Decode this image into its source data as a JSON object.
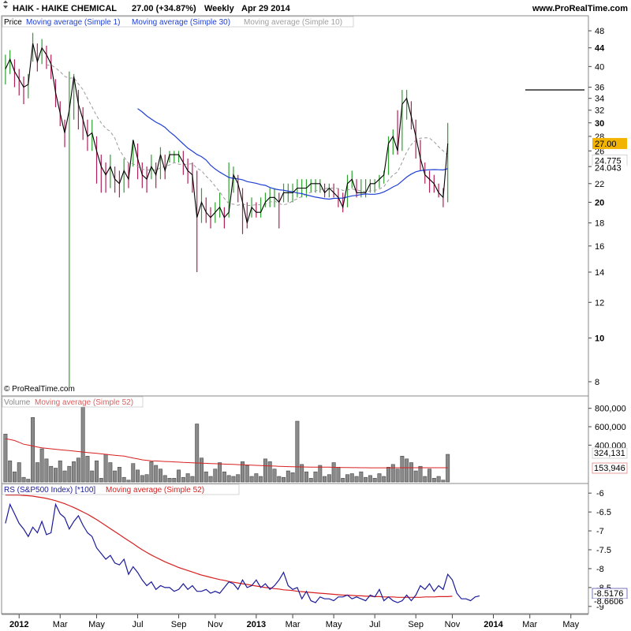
{
  "header": {
    "title": "HAIK - HAIKE CHEMICAL",
    "quote": "27.00 (+34.87%)",
    "period": "Weekly",
    "date": "Apr 29 2014",
    "site": "www.ProRealTime.com"
  },
  "copyright": "© ProRealTime.com",
  "colors": {
    "up": "#2ea02e",
    "down": "#b0205a",
    "close_line": "#000000",
    "ma_short": "#1f3fd6",
    "ma_long": "#9a9a9a",
    "volume_bar": "#8a8a8a",
    "ma52": "#d82020",
    "rs_line": "#1a1a9a",
    "price_badge": "#f2b400"
  },
  "chart_data": [
    {
      "type": "line",
      "panel": "price",
      "scale": "log",
      "legend": [
        "Price",
        "Moving average (Simple 1)",
        "Moving average (Simple 30)",
        "Moving average (Simple 10)"
      ],
      "y_ticks": [
        8,
        10,
        12,
        14,
        16,
        18,
        20,
        22,
        24,
        26,
        28,
        30,
        32,
        34,
        36,
        40,
        44,
        48
      ],
      "y_bold_ticks": [
        10,
        20,
        30,
        44
      ],
      "ylim": [
        7.5,
        51
      ],
      "x_labels": [
        {
          "label": "2012",
          "week": 3,
          "bold": true
        },
        {
          "label": "Mar",
          "week": 12
        },
        {
          "label": "May",
          "week": 20
        },
        {
          "label": "Jul",
          "week": 29
        },
        {
          "label": "Sep",
          "week": 38
        },
        {
          "label": "Nov",
          "week": 46
        },
        {
          "label": "2013",
          "week": 55,
          "bold": true
        },
        {
          "label": "Mar",
          "week": 63
        },
        {
          "label": "May",
          "week": 72
        },
        {
          "label": "Jul",
          "week": 81
        },
        {
          "label": "Sep",
          "week": 90
        },
        {
          "label": "Nov",
          "week": 98
        },
        {
          "label": "2014",
          "week": 107,
          "bold": true
        },
        {
          "label": "Mar",
          "week": 115
        },
        {
          "label": "May",
          "week": 124
        }
      ],
      "close": [
        39.5,
        41.5,
        39,
        37.5,
        36,
        36.5,
        45,
        41,
        44,
        42.5,
        40.5,
        35,
        31.5,
        28.5,
        32,
        38,
        33,
        30.5,
        28,
        28.5,
        26,
        24,
        23,
        24,
        22.5,
        22,
        23.5,
        22.5,
        27.5,
        25,
        23,
        22.5,
        24,
        23,
        25.5,
        23.5,
        25.5,
        25.5,
        25.5,
        24.5,
        23.5,
        23,
        18.5,
        20,
        19,
        18.5,
        19,
        19.5,
        18.5,
        19,
        23,
        22,
        20,
        18,
        19.5,
        19,
        19,
        20,
        20.5,
        20.5,
        20,
        21,
        21,
        21,
        21.5,
        21.5,
        21.5,
        22,
        22,
        22,
        21,
        21.5,
        21,
        20.5,
        19.5,
        22,
        22.5,
        21,
        21,
        21,
        22,
        22,
        22.5,
        23,
        27,
        28,
        26,
        33,
        34,
        31,
        28,
        25,
        23,
        22.5,
        22,
        21,
        20.5,
        27
      ],
      "high": [
        42.5,
        43.5,
        41.5,
        39.5,
        38,
        38.5,
        47.5,
        45,
        46,
        44.5,
        42.5,
        37.5,
        33.5,
        30.5,
        39,
        38.5,
        35.5,
        32.5,
        30.5,
        30.5,
        28,
        25.5,
        24.5,
        25.5,
        24,
        23.5,
        25,
        24.5,
        27.5,
        27,
        24.5,
        24,
        25.5,
        24.5,
        26.5,
        25.5,
        26,
        26,
        26,
        26,
        25,
        24.5,
        23.5,
        21.5,
        20.5,
        19.5,
        20,
        21,
        19.5,
        24.5,
        24,
        23,
        21.5,
        20,
        20.5,
        20,
        20.5,
        21,
        21.5,
        21.5,
        21,
        22,
        22,
        22,
        22.5,
        22.5,
        22.5,
        22.5,
        22.5,
        22.5,
        22,
        22,
        22,
        21.5,
        21,
        23,
        23.5,
        22.5,
        22.5,
        22.5,
        22.5,
        22.5,
        23,
        23.5,
        28,
        29,
        32,
        35.5,
        35.5,
        33.5,
        30.5,
        27.5,
        24.5,
        23.5,
        23,
        22,
        21.5,
        30
      ],
      "low": [
        36.5,
        38.5,
        36,
        34.5,
        33,
        34,
        41,
        39,
        40.5,
        39.5,
        37.5,
        32.5,
        29.5,
        26.5,
        7.8,
        30.5,
        29,
        27.5,
        26,
        26,
        22,
        21,
        21,
        21.5,
        21,
        20.5,
        21,
        21.5,
        24,
        22.5,
        21.5,
        21,
        22.5,
        21.5,
        22.5,
        22.5,
        24.5,
        24.5,
        24.5,
        23,
        22,
        21,
        14,
        18,
        18,
        17.5,
        18,
        18.5,
        17.5,
        18.5,
        21,
        20,
        17,
        17.5,
        18.5,
        18.5,
        18.5,
        19.5,
        19.5,
        19.5,
        17.5,
        20,
        20,
        20,
        20.5,
        20.5,
        20.5,
        21,
        21,
        21,
        20.5,
        20.5,
        20.5,
        19.5,
        19,
        19.5,
        21.5,
        20.5,
        20.5,
        20.5,
        21,
        21,
        21.5,
        22,
        23,
        25.5,
        25.5,
        26,
        30.5,
        29,
        25,
        23.5,
        22,
        21,
        21,
        20.5,
        19.5,
        20
      ],
      "resistance_line": {
        "start_week": 114,
        "end_week": 127,
        "value": 35.5
      },
      "last_price": 27.0,
      "ma10_last": 24.775,
      "ma30_last": 24.043,
      "ma10_label": "24.775",
      "ma30_label": "24.043",
      "last_price_label": "27.00"
    },
    {
      "type": "bar",
      "panel": "volume",
      "legend": [
        "Volume",
        "Moving average (Simple 52)"
      ],
      "y_ticks": [
        400000,
        600000,
        800000
      ],
      "y_tick_labels": [
        "400,000",
        "600,000",
        "800,000"
      ],
      "ylim": [
        0,
        900000
      ],
      "values": [
        520000,
        230000,
        110000,
        210000,
        50000,
        30000,
        700000,
        210000,
        360000,
        250000,
        170000,
        150000,
        230000,
        120000,
        170000,
        220000,
        260000,
        860000,
        280000,
        120000,
        230000,
        40000,
        300000,
        210000,
        120000,
        160000,
        50000,
        20000,
        200000,
        130000,
        70000,
        80000,
        220000,
        180000,
        140000,
        70000,
        40000,
        40000,
        130000,
        50000,
        90000,
        60000,
        630000,
        260000,
        110000,
        60000,
        140000,
        210000,
        110000,
        70000,
        60000,
        80000,
        220000,
        180000,
        60000,
        90000,
        60000,
        250000,
        220000,
        140000,
        60000,
        50000,
        120000,
        100000,
        660000,
        190000,
        110000,
        40000,
        110000,
        180000,
        60000,
        80000,
        210000,
        160000,
        40000,
        80000,
        90000,
        60000,
        110000,
        50000,
        70000,
        40000,
        90000,
        60000,
        160000,
        190000,
        140000,
        280000,
        250000,
        210000,
        120000,
        170000,
        60000,
        140000,
        40000,
        60000,
        20000,
        300000
      ],
      "ma52": [
        470000,
        460000,
        450000,
        430000,
        410000,
        400000,
        390000,
        380000,
        370000,
        365000,
        360000,
        355000,
        350000,
        345000,
        340000,
        335000,
        330000,
        325000,
        320000,
        315000,
        310000,
        305000,
        300000,
        295000,
        290000,
        285000,
        280000,
        270000,
        260000,
        250000,
        240000,
        235000,
        230000,
        228000,
        225000,
        222000,
        220000,
        218000,
        215000,
        212000,
        210000,
        208000,
        206000,
        204000,
        202000,
        200000,
        198000,
        196000,
        194000,
        192000,
        190000,
        188000,
        186000,
        184000,
        182000,
        180000,
        178000,
        176000,
        174000,
        172000,
        170000,
        168000,
        166000,
        165000,
        164000,
        163000,
        162000,
        161000,
        160000,
        160000,
        160000,
        160000,
        159000,
        158000,
        157000,
        156000,
        155000,
        155000,
        154000,
        154000,
        153000,
        153000,
        153000,
        153000,
        153000,
        153000,
        154000,
        154000,
        154000,
        154000,
        154000,
        154000,
        154000,
        154000,
        154000,
        154000,
        154000,
        153946
      ],
      "last_value_label": "324,131",
      "ma52_label": "153,946"
    },
    {
      "type": "line",
      "panel": "rs",
      "legend": [
        "RS (S&P500 Index) [*100]",
        "Moving average (Simple 52)"
      ],
      "y_ticks": [
        -6,
        -6.5,
        -7,
        -7.5,
        -8,
        -8.5,
        -9
      ],
      "ylim": [
        -9.15,
        -5.85
      ],
      "rs": [
        -6.8,
        -6.3,
        -6.55,
        -6.8,
        -6.95,
        -7.15,
        -6.9,
        -7.05,
        -6.75,
        -7.1,
        -7.05,
        -6.3,
        -6.55,
        -6.65,
        -6.95,
        -6.75,
        -6.6,
        -6.85,
        -7.05,
        -7.15,
        -7.45,
        -7.6,
        -7.75,
        -7.65,
        -7.85,
        -7.9,
        -7.75,
        -8.15,
        -7.95,
        -8.1,
        -8.3,
        -8.45,
        -8.35,
        -8.55,
        -8.45,
        -8.5,
        -8.5,
        -8.6,
        -8.55,
        -8.4,
        -8.55,
        -8.45,
        -8.6,
        -8.6,
        -8.55,
        -8.65,
        -8.6,
        -8.65,
        -8.5,
        -8.35,
        -8.4,
        -8.55,
        -8.3,
        -8.5,
        -8.45,
        -8.3,
        -8.5,
        -8.4,
        -8.55,
        -8.45,
        -8.3,
        -8.1,
        -8.45,
        -8.55,
        -8.5,
        -8.8,
        -8.6,
        -8.85,
        -8.9,
        -8.75,
        -8.8,
        -8.8,
        -8.85,
        -8.75,
        -8.75,
        -8.7,
        -8.8,
        -8.75,
        -8.8,
        -8.85,
        -8.7,
        -8.75,
        -8.55,
        -8.85,
        -8.75,
        -8.85,
        -8.9,
        -8.85,
        -8.7,
        -8.85,
        -8.7,
        -8.45,
        -8.55,
        -8.4,
        -8.6,
        -8.45,
        -8.55,
        -8.15,
        -8.3,
        -8.65,
        -8.8,
        -8.8,
        -8.85,
        -8.75,
        -8.72
      ],
      "ma52": [
        -6.05,
        -6.05,
        -6.05,
        -6.05,
        -6.06,
        -6.07,
        -6.08,
        -6.1,
        -6.12,
        -6.14,
        -6.17,
        -6.2,
        -6.24,
        -6.28,
        -6.33,
        -6.38,
        -6.44,
        -6.5,
        -6.56,
        -6.63,
        -6.7,
        -6.78,
        -6.86,
        -6.94,
        -7.02,
        -7.1,
        -7.18,
        -7.26,
        -7.34,
        -7.42,
        -7.5,
        -7.57,
        -7.64,
        -7.7,
        -7.76,
        -7.82,
        -7.87,
        -7.92,
        -7.97,
        -8.01,
        -8.05,
        -8.09,
        -8.13,
        -8.17,
        -8.2,
        -8.23,
        -8.26,
        -8.29,
        -8.31,
        -8.34,
        -8.36,
        -8.38,
        -8.4,
        -8.42,
        -8.44,
        -8.46,
        -8.48,
        -8.5,
        -8.51,
        -8.53,
        -8.54,
        -8.56,
        -8.57,
        -8.58,
        -8.6,
        -8.61,
        -8.62,
        -8.63,
        -8.64,
        -8.65,
        -8.66,
        -8.67,
        -8.68,
        -8.69,
        -8.7,
        -8.7,
        -8.71,
        -8.72,
        -8.72,
        -8.73,
        -8.73,
        -8.74,
        -8.74,
        -8.75,
        -8.75,
        -8.75,
        -8.76,
        -8.76,
        -8.76,
        -8.76,
        -8.76,
        -8.76,
        -8.75,
        -8.75,
        -8.75,
        -8.74,
        -8.74,
        -8.74,
        -8.73
      ],
      "last_value_label": "-8.5176",
      "ma52_label": "-8.6606"
    }
  ]
}
